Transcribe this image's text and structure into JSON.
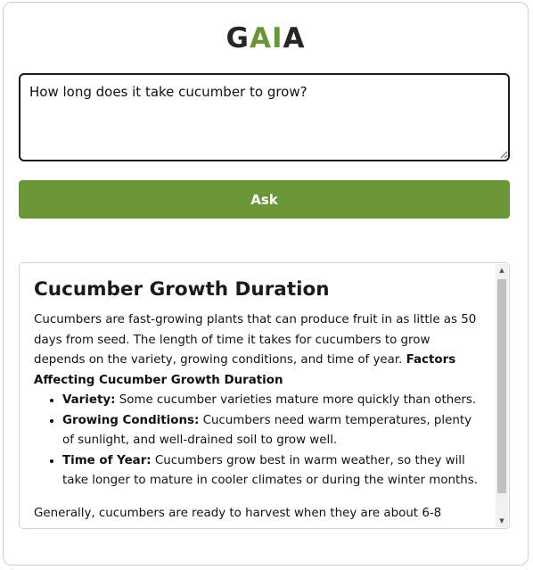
{
  "app": {
    "logo": {
      "parts": [
        "G",
        "A",
        "I",
        "A"
      ],
      "colors": {
        "dark": "#262626",
        "green": "#6a9636"
      }
    }
  },
  "form": {
    "question_value": "How long does it take cucumber to grow?",
    "ask_label": "Ask",
    "accent_color": "#6a9638"
  },
  "answer": {
    "title": "Cucumber Growth Duration",
    "intro": "Cucumbers are fast-growing plants that can produce fruit in as little as 50 days from seed. The length of time it takes for cucumbers to grow depends on the variety, growing conditions, and time of year.",
    "factors_heading": "Factors Affecting Cucumber Growth Duration",
    "factors": [
      {
        "term": "Variety:",
        "text": "Some cucumber varieties mature more quickly than others."
      },
      {
        "term": "Growing Conditions:",
        "text": "Cucumbers need warm temperatures, plenty of sunlight, and well-drained soil to grow well."
      },
      {
        "term": "Time of Year:",
        "text": "Cucumbers grow best in warm weather, so they will take longer to mature in cooler climates or during the winter months."
      }
    ],
    "conclusion": "Generally, cucumbers are ready to harvest when they are about 6-8"
  },
  "icons": {
    "scroll_up": "scroll-up-arrow-icon",
    "scroll_down": "scroll-down-arrow-icon",
    "resize": "resize-grip-icon"
  }
}
